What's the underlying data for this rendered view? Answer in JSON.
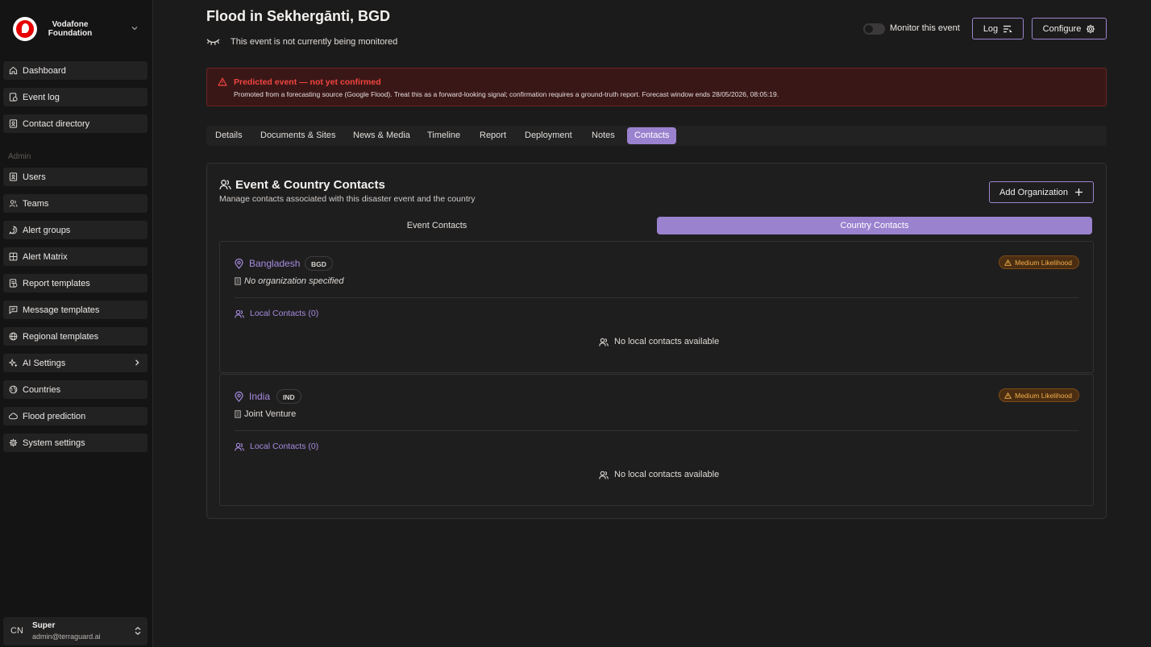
{
  "brand": {
    "name_line1": "Vodafone",
    "name_line2": "Foundation"
  },
  "sidebar": {
    "items": [
      {
        "label": "Dashboard",
        "icon": "home-icon"
      },
      {
        "label": "Event log",
        "icon": "event-log-icon"
      },
      {
        "label": "Contact directory",
        "icon": "contact-directory-icon"
      }
    ],
    "admin_section_label": "Admin",
    "admin_items": [
      {
        "label": "Users",
        "icon": "users-icon"
      },
      {
        "label": "Teams",
        "icon": "teams-icon"
      },
      {
        "label": "Alert groups",
        "icon": "alert-groups-icon"
      },
      {
        "label": "Alert Matrix",
        "icon": "alert-matrix-icon"
      },
      {
        "label": "Report templates",
        "icon": "report-templates-icon"
      },
      {
        "label": "Message templates",
        "icon": "message-templates-icon"
      },
      {
        "label": "Regional templates",
        "icon": "globe-icon"
      },
      {
        "label": "AI Settings",
        "icon": "sparkles-icon"
      },
      {
        "label": "Countries",
        "icon": "countries-icon"
      },
      {
        "label": "Flood prediction",
        "icon": "cloud-icon"
      },
      {
        "label": "System settings",
        "icon": "gear-icon"
      }
    ]
  },
  "user": {
    "initials": "CN",
    "name": "Super",
    "email": "admin@terraguard.ai"
  },
  "header": {
    "title": "Flood in Sekhergānti, BGD",
    "monitor_status": "This event is not currently being monitored",
    "monitor_toggle_label": "Monitor this event",
    "monitor_enabled": false,
    "log_label": "Log",
    "configure_label": "Configure"
  },
  "alert": {
    "title": "Predicted event — not yet confirmed",
    "text": "Promoted from a forecasting source (Google Flood). Treat this as a forward-looking signal; confirmation requires a ground-truth report. Forecast window ends 28/05/2026, 08:05:19."
  },
  "tabs": [
    {
      "label": "Details"
    },
    {
      "label": "Documents & Sites"
    },
    {
      "label": "News & Media"
    },
    {
      "label": "Timeline"
    },
    {
      "label": "Report"
    },
    {
      "label": "Deployment"
    },
    {
      "label": "Notes"
    },
    {
      "label": "Contacts",
      "active": true
    }
  ],
  "contacts": {
    "title": "Event & Country Contacts",
    "subtitle": "Manage contacts associated with this disaster event and the country",
    "add_org_label": "Add Organization",
    "subtabs": [
      {
        "label": "Event Contacts"
      },
      {
        "label": "Country Contacts",
        "active": true
      }
    ],
    "countries": [
      {
        "name": "Bangladesh",
        "code": "BGD",
        "likelihood": "Medium Likelihood",
        "organization": "No organization specified",
        "local_contacts_label": "Local Contacts (0)",
        "empty_text": "No local contacts available"
      },
      {
        "name": "India",
        "code": "IND",
        "likelihood": "Medium Likelihood",
        "organization": "Joint Venture",
        "local_contacts_label": "Local Contacts (0)",
        "empty_text": "No local contacts available"
      }
    ]
  },
  "colors": {
    "accent": "#9b82cf",
    "alert_red": "#f0453f",
    "likelihood_amber": "#f2b04a",
    "background": "#1c1b1b"
  }
}
